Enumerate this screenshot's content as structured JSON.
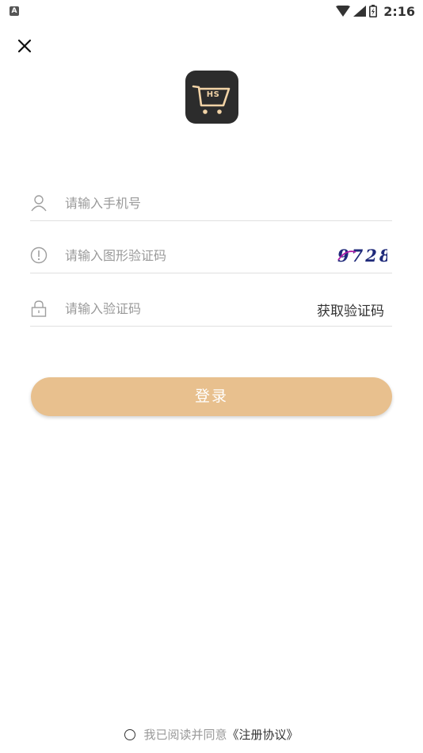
{
  "status_bar": {
    "notification_letter": "A",
    "time": "2:16",
    "icons": [
      "wifi-icon",
      "signal-icon",
      "battery-icon"
    ]
  },
  "header": {
    "close_icon": "close-icon"
  },
  "logo": {
    "text": "HS",
    "background": "#2c2c2c",
    "accent": "#f2d3a6"
  },
  "form": {
    "phone": {
      "placeholder": "请输入手机号",
      "value": "",
      "icon": "user-icon"
    },
    "captcha": {
      "placeholder": "请输入图形验证码",
      "value": "",
      "icon": "info-icon",
      "captcha_text": "9728"
    },
    "sms_code": {
      "placeholder": "请输入验证码",
      "value": "",
      "icon": "lock-icon",
      "get_code_label": "获取验证码"
    },
    "login_label": "登录",
    "login_color": "#e8c08e"
  },
  "agreement": {
    "prefix": "我已阅读并同意",
    "link": "《注册协议》",
    "checked": false
  }
}
